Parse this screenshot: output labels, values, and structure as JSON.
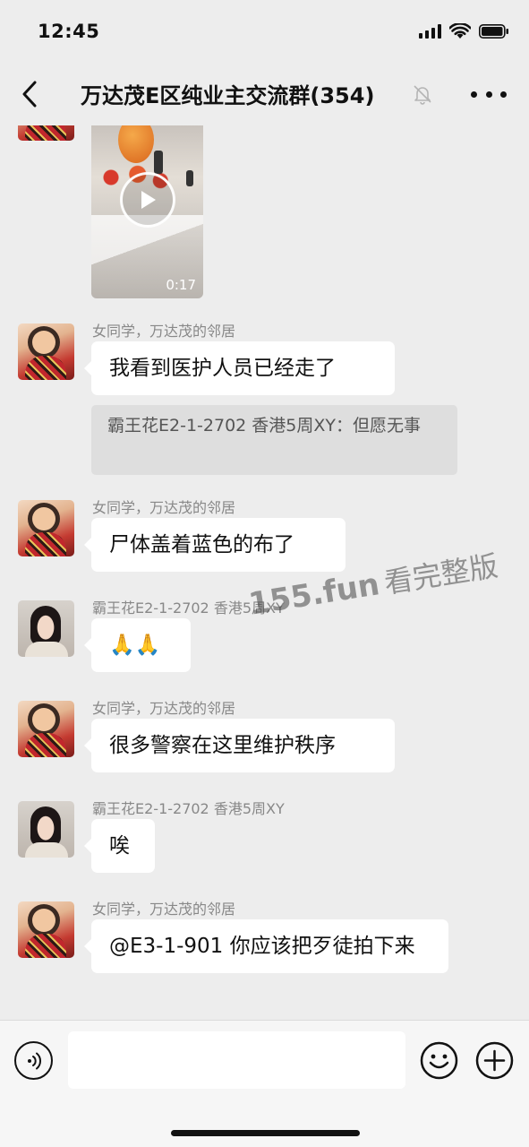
{
  "status_bar": {
    "time": "12:45"
  },
  "header": {
    "title": "万达茂E区纯业主交流群(354)",
    "icons": {
      "back": "chevron-left-icon",
      "mute": "bell-off-icon",
      "more": "more-dots-icon"
    }
  },
  "video": {
    "duration": "0:17",
    "icon": "play-icon"
  },
  "messages": [
    {
      "sender": "女同学，万达茂的邻居",
      "text": "我看到医护人员已经走了",
      "quote": "霸王花E2-1-2702 香港5周XY：但愿无事"
    },
    {
      "sender": "女同学，万达茂的邻居",
      "text": "尸体盖着蓝色的布了"
    },
    {
      "sender": "霸王花E2-1-2702 香港5周XY",
      "text": "🙏🙏"
    },
    {
      "sender": "女同学，万达茂的邻居",
      "text": "很多警察在这里维护秩序"
    },
    {
      "sender": "霸王花E2-1-2702 香港5周XY",
      "text": "唉"
    },
    {
      "sender": "女同学，万达茂的邻居",
      "text": "@E3-1-901 你应该把歹徒拍下来"
    }
  ],
  "watermark": {
    "site": "155.fun",
    "text": "看完整版"
  },
  "input_bar": {
    "value": "",
    "icons": {
      "voice": "voice-icon",
      "emoji": "emoji-icon",
      "plus": "plus-icon"
    }
  }
}
